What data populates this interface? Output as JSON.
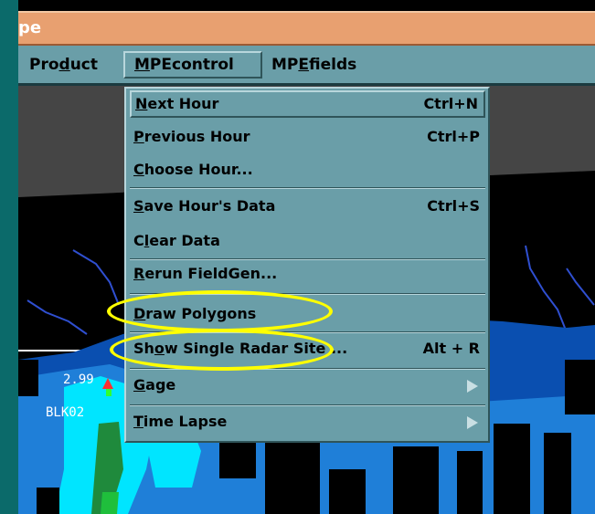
{
  "window": {
    "title": "pe"
  },
  "menubar": {
    "items": [
      {
        "label_pre": "Pro",
        "label_u": "d",
        "label_post": "uct"
      },
      {
        "label_pre": "",
        "label_u": "M",
        "label_post": "PEcontrol"
      },
      {
        "label_pre": "MP",
        "label_u": "E",
        "label_post": "fields"
      }
    ]
  },
  "dropdown": {
    "items": [
      {
        "label_pre": "",
        "label_u": "N",
        "label_post": "ext Hour",
        "accel": "Ctrl+N"
      },
      {
        "label_pre": "",
        "label_u": "P",
        "label_post": "revious Hour",
        "accel": "Ctrl+P"
      },
      {
        "label_pre": "",
        "label_u": "C",
        "label_post": "hoose Hour...",
        "accel": ""
      },
      {
        "label_pre": "",
        "label_u": "S",
        "label_post": "ave Hour's Data",
        "accel": "Ctrl+S"
      },
      {
        "label_pre": "C",
        "label_u": "l",
        "label_post": "ear Data",
        "accel": ""
      },
      {
        "label_pre": "",
        "label_u": "R",
        "label_post": "erun FieldGen...",
        "accel": ""
      },
      {
        "label_pre": "",
        "label_u": "D",
        "label_post": "raw Polygons",
        "accel": ""
      },
      {
        "label_pre": "Sh",
        "label_u": "o",
        "label_post": "w Single Radar Site ...",
        "accel": "Alt + R"
      },
      {
        "label_pre": "",
        "label_u": "G",
        "label_post": "age",
        "accel": ""
      },
      {
        "label_pre": "",
        "label_u": "T",
        "label_post": "ime Lapse",
        "accel": ""
      }
    ]
  },
  "map": {
    "labels": [
      {
        "text": "2.99"
      },
      {
        "text": "BLK02"
      }
    ]
  },
  "colors": {
    "menu_bg": "#6a9ea8",
    "title_bg": "#e8a070",
    "highlight": "#ffff00",
    "radar_light": "#00e5ff",
    "radar_mid": "#1f7fd8",
    "radar_dark": "#0a4fb0"
  }
}
